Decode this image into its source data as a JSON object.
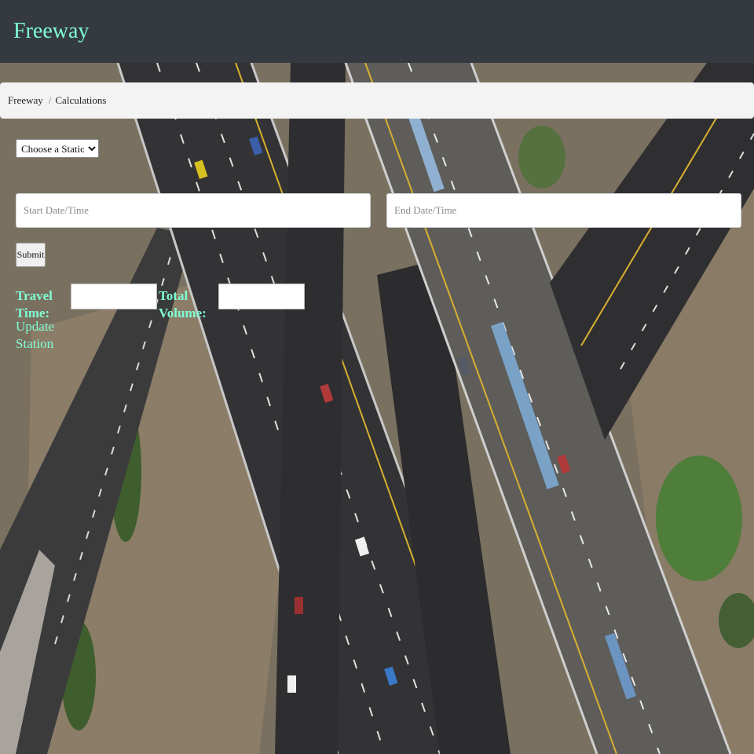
{
  "navbar": {
    "brand": "Freeway"
  },
  "breadcrumb": {
    "home": "Freeway",
    "separator": "/",
    "current": "Calculations"
  },
  "form": {
    "station_select": {
      "selected": "Choose a Station",
      "options": [
        "Choose a Station"
      ]
    },
    "start_datetime": {
      "placeholder": "Start Date/Time",
      "value": ""
    },
    "end_datetime": {
      "placeholder": "End Date/Time",
      "value": ""
    },
    "submit_label": "Submit",
    "travel_time": {
      "label": "Travel Time:",
      "value": ""
    },
    "total_volume": {
      "label": "Total Volume:",
      "value": ""
    },
    "update_station_label": "Update Station"
  },
  "colors": {
    "navbar_bg": "#343a40",
    "accent": "#7fffd4",
    "breadcrumb_bg": "#f3f3f3"
  }
}
